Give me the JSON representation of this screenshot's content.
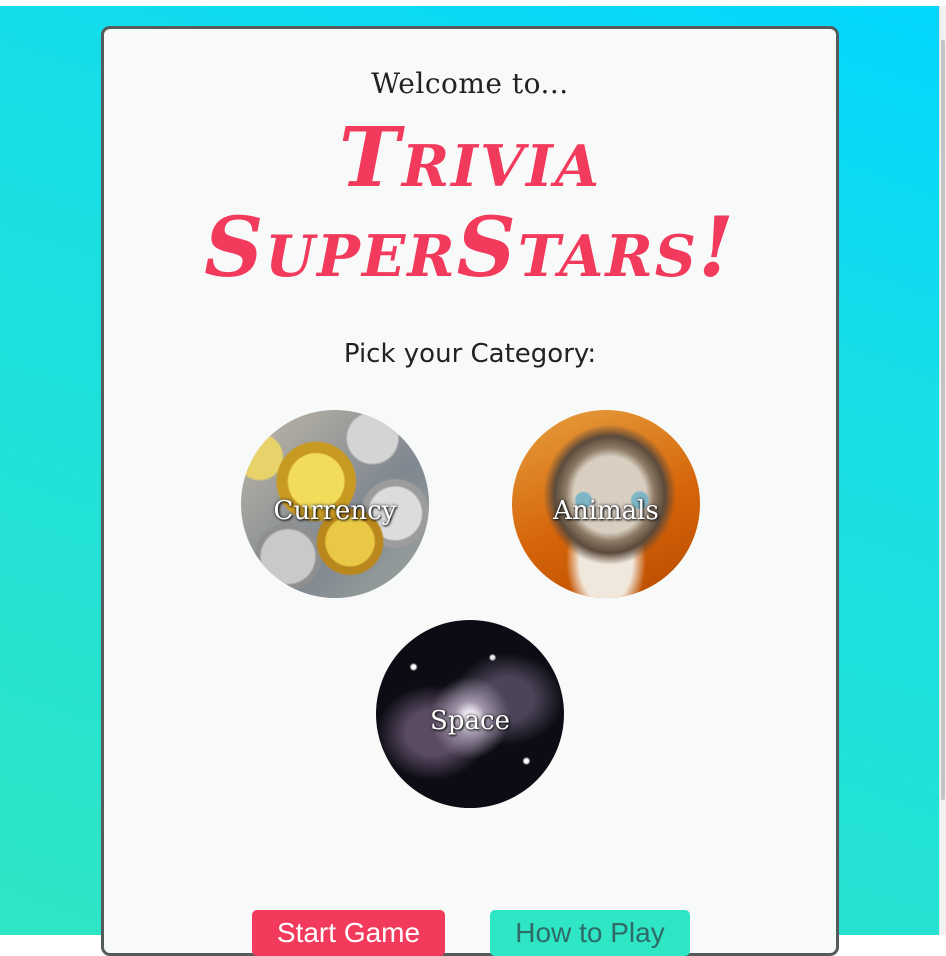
{
  "header": {
    "welcome": "Welcome to...",
    "title_line1": "Trivia",
    "title_line2": "SuperStars!"
  },
  "category_prompt": "Pick your Category:",
  "categories": [
    {
      "label": "Currency"
    },
    {
      "label": "Animals"
    },
    {
      "label": "Space"
    }
  ],
  "buttons": {
    "start": "Start Game",
    "how": "How to Play"
  },
  "colors": {
    "accent": "#f23a5c",
    "teal": "#2ee6c4",
    "background_top": "#00d6ff",
    "card": "#f8faf9"
  }
}
